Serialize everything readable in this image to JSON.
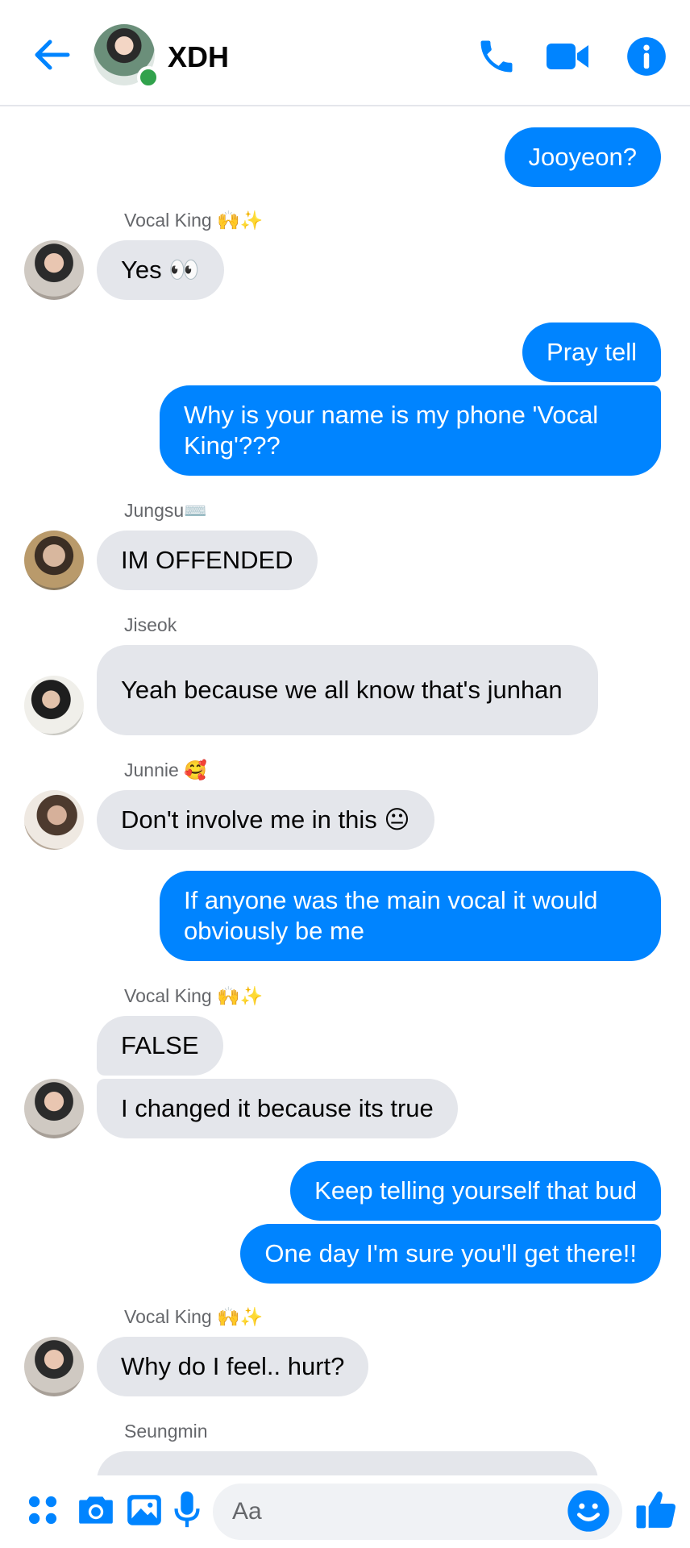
{
  "header": {
    "title": "XDH"
  },
  "messages": [
    {
      "type": "out",
      "text": "Jooyeon?"
    },
    {
      "type": "sender",
      "text": "Vocal King 🙌✨"
    },
    {
      "type": "in",
      "text": "Yes 👀"
    },
    {
      "type": "out",
      "text": "Pray tell"
    },
    {
      "type": "out",
      "text": "Why is your name is my phone 'Vocal King'???"
    },
    {
      "type": "sender",
      "text": "Jungsu⌨️"
    },
    {
      "type": "in",
      "text": "IM OFFENDED"
    },
    {
      "type": "sender",
      "text": "Jiseok"
    },
    {
      "type": "in",
      "text": "Yeah because we all know that's junhan"
    },
    {
      "type": "sender",
      "text": "Junnie 🥰"
    },
    {
      "type": "in",
      "text": "Don't involve me in this 😐"
    },
    {
      "type": "out",
      "text": "If anyone was the main vocal it would obviously be me"
    },
    {
      "type": "sender",
      "text": "Vocal King 🙌✨"
    },
    {
      "type": "in",
      "text": "FALSE"
    },
    {
      "type": "in",
      "text": "I changed it because its true"
    },
    {
      "type": "out",
      "text": "Keep telling yourself that bud"
    },
    {
      "type": "out",
      "text": "One day I'm sure you'll get there!!"
    },
    {
      "type": "sender",
      "text": "Vocal King 🙌✨"
    },
    {
      "type": "in",
      "text": "Why do I feel.. hurt?"
    },
    {
      "type": "sender",
      "text": "Seungmin"
    }
  ],
  "composer": {
    "placeholder": "Aa"
  },
  "colors": {
    "accent": "#0084ff",
    "incoming_bubble": "#e4e6eb",
    "online": "#31a24c"
  },
  "icons": [
    "back-arrow-icon",
    "phone-icon",
    "video-camera-icon",
    "info-icon",
    "apps-icon",
    "camera-icon",
    "gallery-icon",
    "microphone-icon",
    "emoji-icon",
    "thumbs-up-icon"
  ]
}
